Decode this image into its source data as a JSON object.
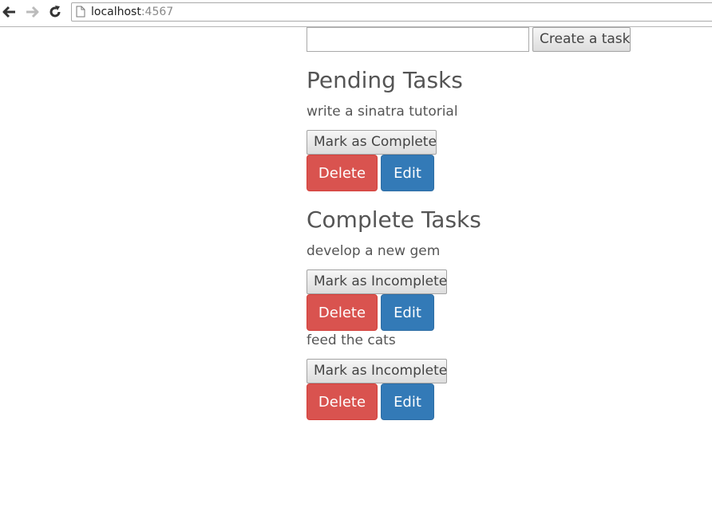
{
  "browser": {
    "url_host": "localhost",
    "url_port": ":4567",
    "icons": {
      "back": "back-arrow-icon",
      "forward": "forward-arrow-icon",
      "reload": "reload-icon",
      "page": "page-icon"
    }
  },
  "create_form": {
    "input_value": "",
    "button_label": "Create a task"
  },
  "pending": {
    "title": "Pending Tasks",
    "tasks": [
      {
        "text": "write a sinatra tutorial",
        "toggle_label": "Mark as Complete",
        "delete_label": "Delete",
        "edit_label": "Edit"
      }
    ]
  },
  "complete": {
    "title": "Complete Tasks",
    "tasks": [
      {
        "text": "develop a new gem",
        "toggle_label": "Mark as Incomplete",
        "delete_label": "Delete",
        "edit_label": "Edit"
      },
      {
        "text": "feed the cats",
        "toggle_label": "Mark as Incomplete",
        "delete_label": "Delete",
        "edit_label": "Edit"
      }
    ]
  },
  "colors": {
    "danger": "#d9534f",
    "primary": "#337ab7",
    "text": "#555555"
  }
}
